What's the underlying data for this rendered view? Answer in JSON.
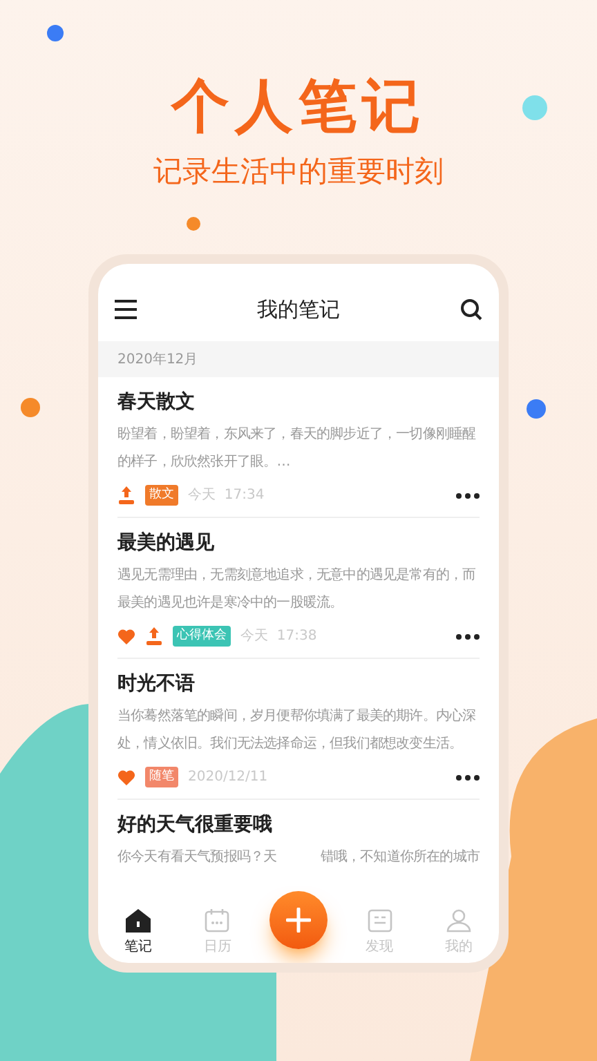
{
  "headline": "个人笔记",
  "tagline": "记录生活中的重要时刻",
  "app": {
    "title": "我的笔记",
    "section": "2020年12月",
    "notes": [
      {
        "title": "春天散文",
        "preview": [
          "盼望着，盼望着，东风来了，春天的脚步近了，一切像刚睡醒的样子，欣欣然张开了眼。…"
        ],
        "liked": false,
        "pinned": true,
        "tag": "散文",
        "color": "#f07a2a",
        "time": "今天  17:34"
      },
      {
        "title": "最美的遇见",
        "preview": [
          "遇见无需理由，无需刻意地追求，无意中的遇见是常有的，而最美的遇见也许是寒冷中的一股暖流。"
        ],
        "liked": true,
        "pinned": true,
        "tag": "心得体会",
        "color": "#3cc4b4",
        "time": "今天  17:38"
      },
      {
        "title": "时光不语",
        "preview": [
          "当你蓦然落笔的瞬间，岁月便帮你填满了最美的期许。内心深处，情义依旧。我们无法选择命运，但我们都想改变生活。"
        ],
        "liked": true,
        "pinned": false,
        "tag": "随笔",
        "color": "#f2876a",
        "time": "2020/12/11"
      },
      {
        "title": "好的天气很重要哦",
        "preview": [
          "你今天有看天气预报吗？天",
          "错哦，不知道你所在的城市"
        ],
        "liked": false,
        "pinned": false
      }
    ],
    "nav": [
      {
        "label": "笔记",
        "kind": "home",
        "selected": true
      },
      {
        "label": "日历",
        "kind": "calendar",
        "selected": false
      },
      {
        "kind": "add"
      },
      {
        "label": "发现",
        "kind": "discover",
        "selected": false
      },
      {
        "label": "我的",
        "kind": "profile",
        "selected": false
      }
    ]
  }
}
